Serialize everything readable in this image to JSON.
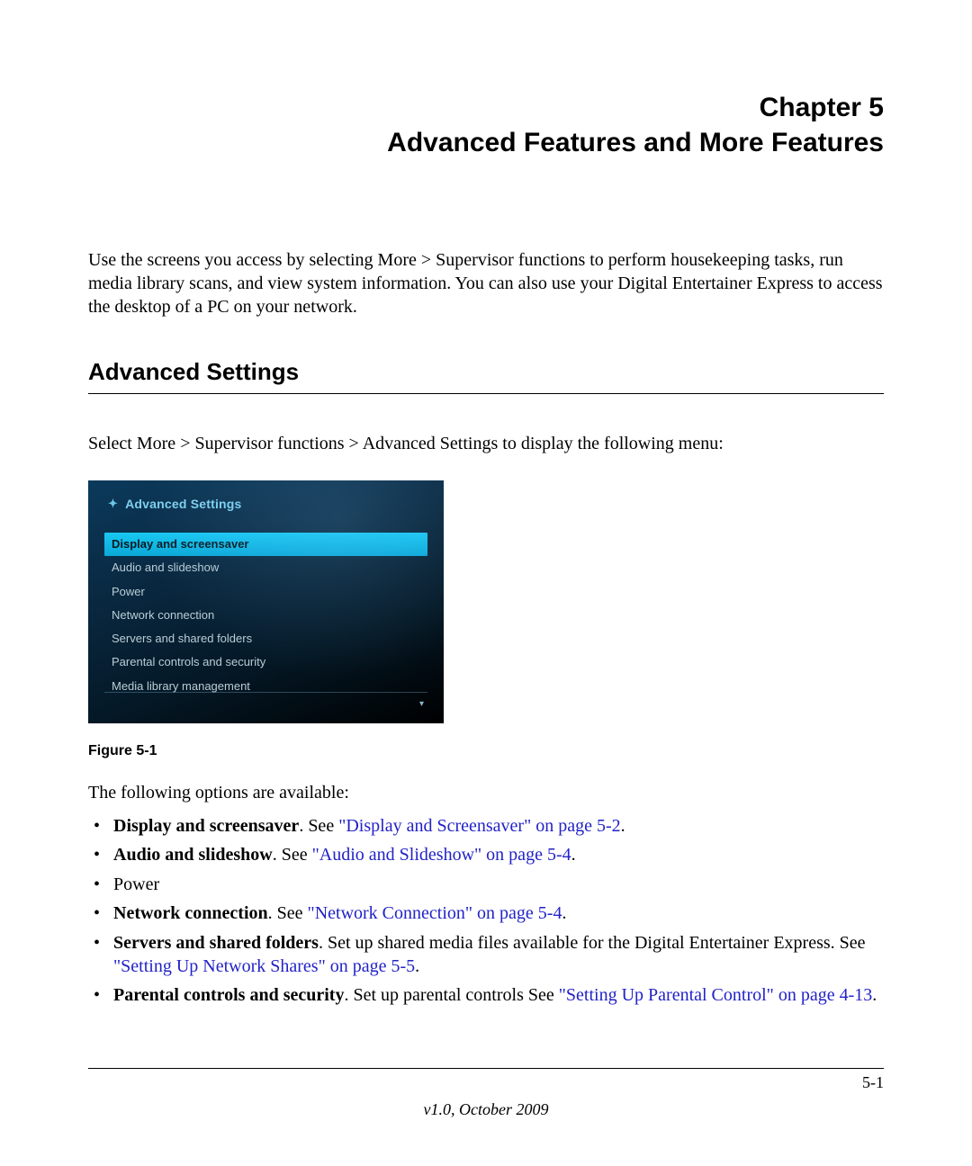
{
  "chapter": {
    "line1": "Chapter 5",
    "line2": "Advanced Features and More Features"
  },
  "intro": "Use the screens you access by selecting More > Supervisor functions to perform housekeeping tasks, run media library scans, and view system information. You can also use your Digital Entertainer Express to access the desktop of a PC on your network.",
  "section_heading": "Advanced Settings",
  "section_intro": "Select More > Supervisor functions > Advanced Settings to display the following menu:",
  "screenshot": {
    "title": "Advanced Settings",
    "menu": [
      "Display and screensaver",
      "Audio and slideshow",
      "Power",
      "Network connection",
      "Servers and shared folders",
      "Parental controls and security",
      "Media library management"
    ],
    "selected_index": 0
  },
  "figure_caption": "Figure 5-1",
  "options_intro": "The following options are available:",
  "options": [
    {
      "bold": "Display and screensaver",
      "plain": ". See ",
      "link": "\"Display and Screensaver\" on page 5-2",
      "tail": "."
    },
    {
      "bold": "Audio and slideshow",
      "plain": ". See ",
      "link": "\"Audio and Slideshow\" on page 5-4",
      "tail": "."
    },
    {
      "bold": "",
      "plain": "Power",
      "link": "",
      "tail": ""
    },
    {
      "bold": "Network connection",
      "plain": ". See ",
      "link": "\"Network Connection\" on page 5-4",
      "tail": "."
    },
    {
      "bold": "Servers and shared folders",
      "plain": ". Set up shared media files available for the Digital Entertainer Express. See ",
      "link": "\"Setting Up Network Shares\" on page 5-5",
      "tail": "."
    },
    {
      "bold": "Parental controls and security",
      "plain": ". Set up parental controls See ",
      "link": "\"Setting Up Parental Control\" on page 4-13",
      "tail": "."
    }
  ],
  "page_number": "5-1",
  "footer_version": "v1.0, October 2009"
}
